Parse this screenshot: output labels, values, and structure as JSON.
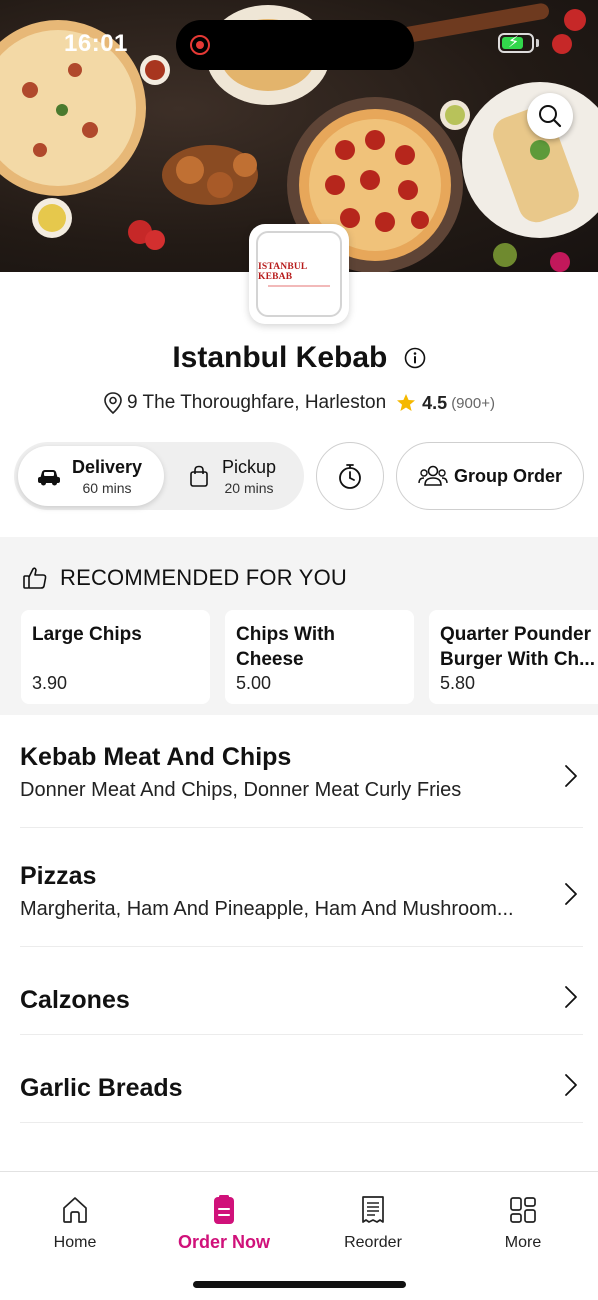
{
  "status_bar": {
    "time": "16:01",
    "battery_level": 0.75,
    "charging": true
  },
  "hero": {
    "search_icon": "search-icon"
  },
  "store": {
    "logo_text": "ISTANBUL KEBAB",
    "name": "Istanbul Kebab",
    "address": "9 The Thoroughfare, Harleston",
    "rating": "4.5",
    "rating_count": "(900+)"
  },
  "modes": {
    "delivery": {
      "label": "Delivery",
      "time": "60 mins",
      "icon": "car-icon",
      "selected": true
    },
    "pickup": {
      "label": "Pickup",
      "time": "20 mins",
      "icon": "bag-icon",
      "selected": false
    },
    "timer_icon": "stopwatch-icon",
    "group_order": {
      "label": "Group Order",
      "icon": "people-icon"
    }
  },
  "recommended": {
    "title": "RECOMMENDED FOR YOU",
    "icon": "thumbs-up-icon",
    "items": [
      {
        "name": "Large Chips",
        "price": "3.90"
      },
      {
        "name": "Chips With\nCheese",
        "price": "5.00"
      },
      {
        "name": "Quarter Pounder\nBurger With Ch...",
        "price": "5.80"
      }
    ]
  },
  "categories": [
    {
      "title": "Kebab Meat And Chips",
      "description": "Donner Meat And Chips, Donner Meat Curly Fries"
    },
    {
      "title": "Pizzas",
      "description": "Margherita, Ham And Pineapple, Ham And Mushroom..."
    },
    {
      "title": "Calzones",
      "description": ""
    },
    {
      "title": "Garlic Breads",
      "description": ""
    }
  ],
  "bottom_nav": [
    {
      "label": "Home",
      "icon": "home-icon",
      "active": false
    },
    {
      "label": "Order Now",
      "icon": "order-icon",
      "active": true
    },
    {
      "label": "Reorder",
      "icon": "receipt-icon",
      "active": false
    },
    {
      "label": "More",
      "icon": "grid-icon",
      "active": false
    }
  ],
  "colors": {
    "accent": "#d0117a",
    "star": "#f5b800"
  }
}
